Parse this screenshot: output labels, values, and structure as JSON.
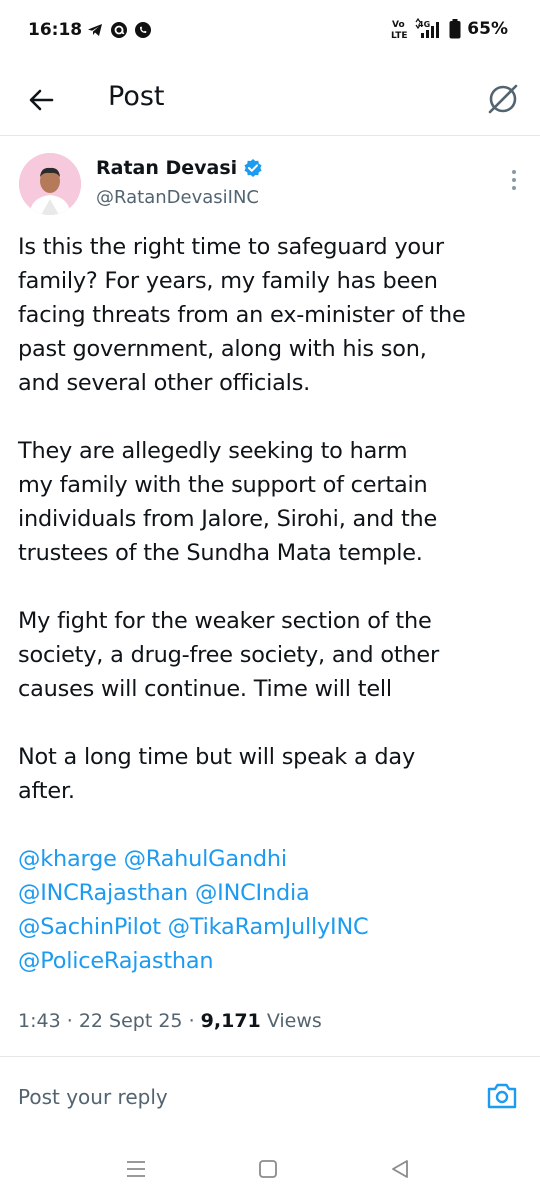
{
  "status_bar": {
    "time": "16:18",
    "battery": "65%",
    "icons_left": [
      "telegram-icon",
      "threads-icon",
      "whatsapp-icon"
    ],
    "icons_right": [
      "volte-icon",
      "4g-signal-icon",
      "battery-icon"
    ]
  },
  "header": {
    "title": "Post",
    "back_icon": "arrow-left-icon",
    "grok_icon": "grok-icon"
  },
  "author": {
    "name": "Ratan Devasi",
    "handle": "@RatanDevasiINC",
    "verified": true
  },
  "post": {
    "paragraphs": [
      "Is this the right time to safeguard your\nfamily? For years, my family has been\nfacing threats from an ex-minister of the\npast government, along with his son,\nand several other officials.",
      "They are allegedly seeking to harm\nmy family with the support of certain\nindividuals from Jalore, Sirohi, and the\ntrustees of the Sundha Mata temple.",
      "My fight for the weaker section of the\nsociety, a drug-free society, and other\ncauses will continue. Time will tell",
      "Not a long time but will speak a day\nafter."
    ],
    "mentions": "@kharge @RahulGandhi\n@INCRajasthan @INCIndia\n@SachinPilot @TikaRamJullyINC\n@PoliceRajasthan"
  },
  "meta": {
    "time": "1:43",
    "date": "22 Sept 25",
    "views_count": "9,171",
    "views_label": "Views"
  },
  "reply": {
    "placeholder": "Post your reply"
  },
  "colors": {
    "link": "#1d9bf0",
    "secondary_text": "#536471",
    "primary_text": "#0f1419"
  }
}
